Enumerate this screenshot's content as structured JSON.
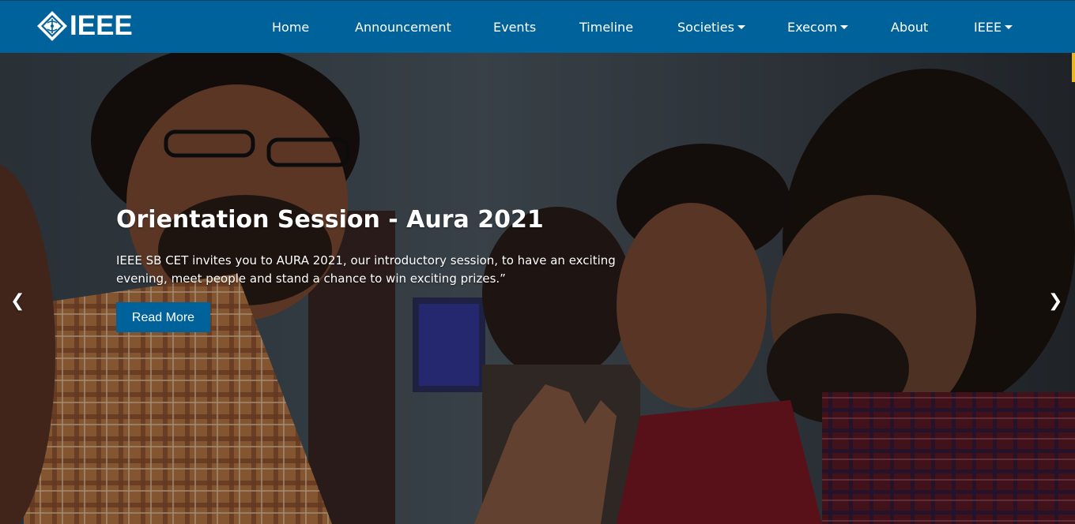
{
  "brand": {
    "logo_text": "IEEE",
    "accent_color": "#00629b"
  },
  "nav": {
    "items": [
      {
        "label": "Home",
        "dropdown": false
      },
      {
        "label": "Announcement",
        "dropdown": false
      },
      {
        "label": "Events",
        "dropdown": false
      },
      {
        "label": "Timeline",
        "dropdown": false
      },
      {
        "label": "Societies",
        "dropdown": true
      },
      {
        "label": "Execom",
        "dropdown": true
      },
      {
        "label": "About",
        "dropdown": false
      },
      {
        "label": "IEEE",
        "dropdown": true
      }
    ]
  },
  "hero": {
    "title": "Orientation Session - Aura 2021",
    "description": "IEEE SB CET invites you to AURA 2021, our introductory session, to have an exciting evening, meet people and stand a chance to win exciting prizes.”",
    "button_label": "Read More",
    "prev_arrow": "❮",
    "next_arrow": "❯",
    "image_icon": "students-photo"
  }
}
